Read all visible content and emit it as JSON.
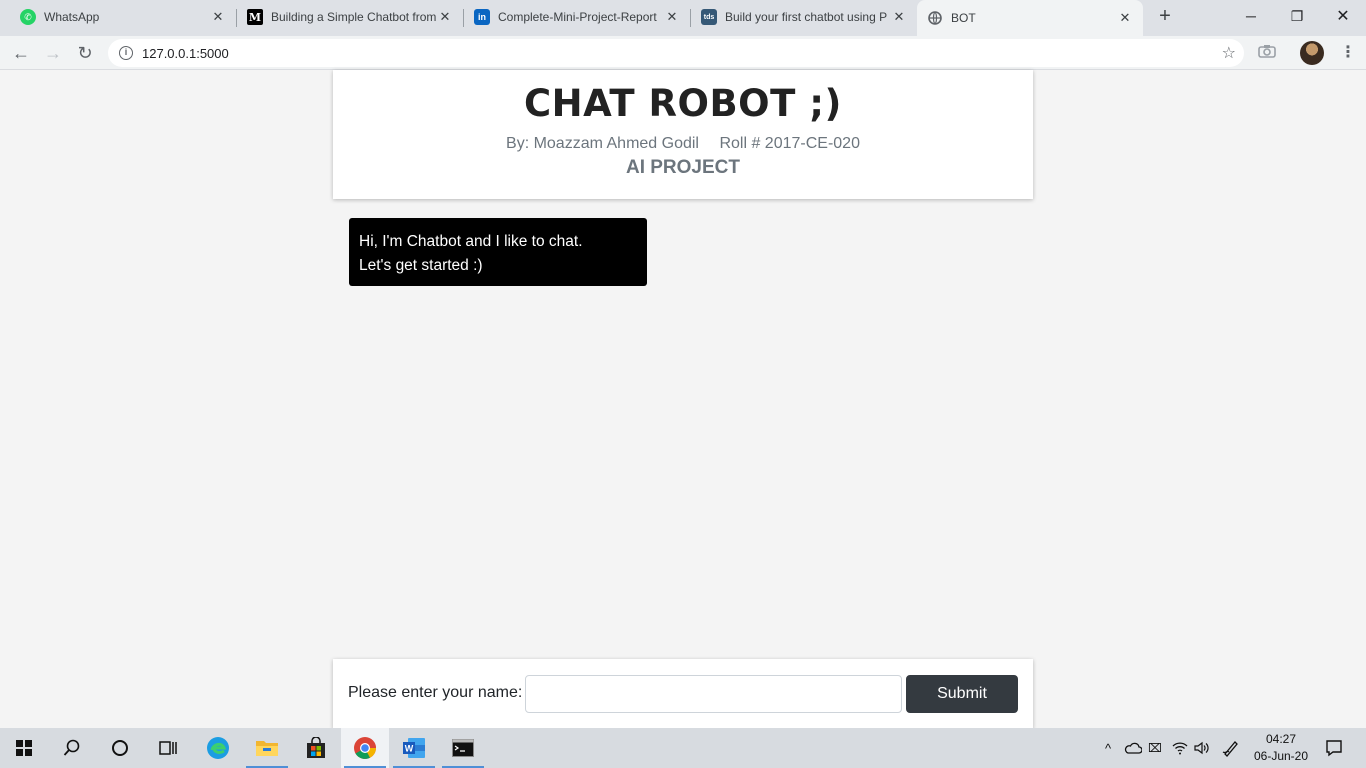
{
  "browser": {
    "tabs": [
      {
        "title": "WhatsApp",
        "icon": "whatsapp-icon",
        "color": "#25d366"
      },
      {
        "title": "Building a Simple Chatbot from",
        "icon": "medium-icon",
        "color": "#000000"
      },
      {
        "title": "Complete-Mini-Project-Report",
        "icon": "linkedin-icon",
        "color": "#0a66c2"
      },
      {
        "title": "Build your first chatbot using P",
        "icon": "tds-icon",
        "color": "#355876"
      },
      {
        "title": "BOT",
        "icon": "globe-icon",
        "color": "#5f6368"
      }
    ],
    "url": "127.0.0.1:5000"
  },
  "page": {
    "title": "CHAT ROBOT ;)",
    "author": "By: Moazzam Ahmed Godil",
    "roll": "Roll # 2017-CE-020",
    "subject": "AI PROJECT",
    "bot_message_line1": "Hi, I'm Chatbot and I like to chat.",
    "bot_message_line2": "Let's get started :)",
    "input_label": "Please enter your name:",
    "input_value": "",
    "submit_label": "Submit"
  },
  "taskbar": {
    "time": "04:27",
    "date": "06-Jun-20"
  },
  "colors": {
    "button_bg": "#343a40",
    "bubble_bg": "#000000",
    "page_bg": "#f4f4f4",
    "muted_text": "#6c757d"
  }
}
